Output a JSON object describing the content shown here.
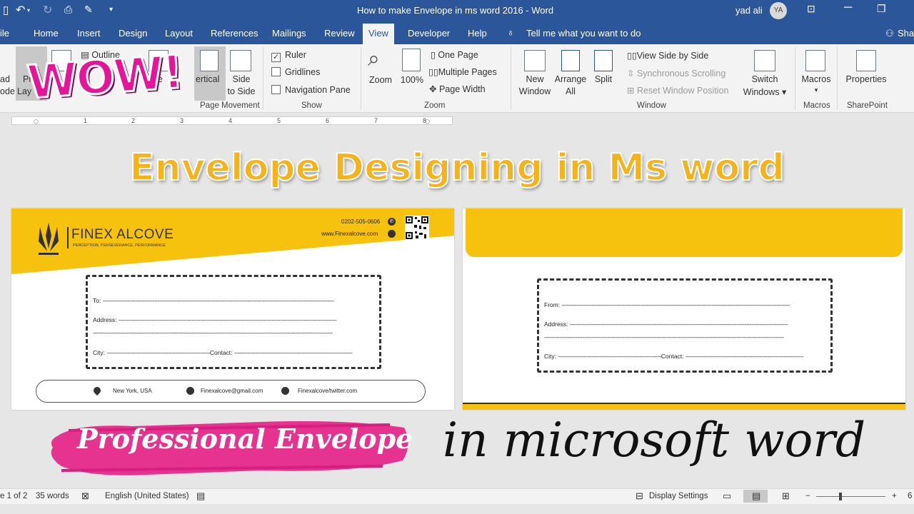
{
  "window": {
    "title": "How to make Envelope in ms word 2016  -  Word",
    "user": "yad ali",
    "avatar": "YA"
  },
  "tabs": [
    "ile",
    "Home",
    "Insert",
    "Design",
    "Layout",
    "References",
    "Mailings",
    "Review",
    "View",
    "Developer",
    "Help"
  ],
  "tell_me": "Tell me what you want to do",
  "share": "Shar",
  "ribbon": {
    "views_left1": "ad",
    "views_left2": "ode",
    "print_layout1": "Pri",
    "print_layout2": "Lay",
    "outline": "Outline",
    "immersive": "mme",
    "vertical": "ertical",
    "side1": "Side",
    "side2": "to Side",
    "page_movement": "Page Movement",
    "ruler": "Ruler",
    "gridlines": "Gridlines",
    "navigation_pane": "Navigation Pane",
    "show": "Show",
    "zoom": "Zoom",
    "zoom100": "100%",
    "one_page": "One Page",
    "multiple_pages": "Multiple Pages",
    "page_width": "Page Width",
    "zoom_group": "Zoom",
    "new_window1": "New",
    "new_window2": "Window",
    "arrange1": "Arrange",
    "arrange2": "All",
    "split": "Split",
    "view_side_by_side": "View Side by Side",
    "sync_scrolling": "Synchronous Scrolling",
    "reset_window": "Reset Window Position",
    "switch1": "Switch",
    "switch2": "Windows",
    "window_group": "Window",
    "macros": "Macros",
    "macros_group": "Macros",
    "properties": "Properties",
    "sharepoint_group": "SharePoint"
  },
  "ruler_numbers": [
    "1",
    "2",
    "3",
    "4",
    "5",
    "6",
    "7",
    "8"
  ],
  "overlay": {
    "wow": "WOW!",
    "heading": "Envelope Designing in Ms word",
    "pro": "Professional Envelope",
    "script": "in microsoft word"
  },
  "envelope1": {
    "company": "FINEX ALCOVE",
    "tagline": "PERCEPTION, PERSEVERANCE, PERFORMANCE",
    "phone": "0202-505-0606",
    "website": "www.Finexalcove.com",
    "to": "To:",
    "address": "Address:",
    "city": "City:",
    "contact": "Contact:",
    "location": "New York, USA",
    "email": "Finexalcove@gmail.com",
    "twitter": "Finexalcove/twitter.com"
  },
  "envelope2": {
    "from": "From:",
    "address": "Address:",
    "city": "City:",
    "contact": "Contact:"
  },
  "status": {
    "page": "e 1 of 2",
    "words": "35 words",
    "language": "English (United States)",
    "display_settings": "Display Settings",
    "zoom": "6"
  },
  "colors": {
    "word_blue": "#2b579a",
    "envelope_yellow": "#f7c20e",
    "heading_orange": "#f5b21b",
    "wow_pink": "#e4149b"
  }
}
